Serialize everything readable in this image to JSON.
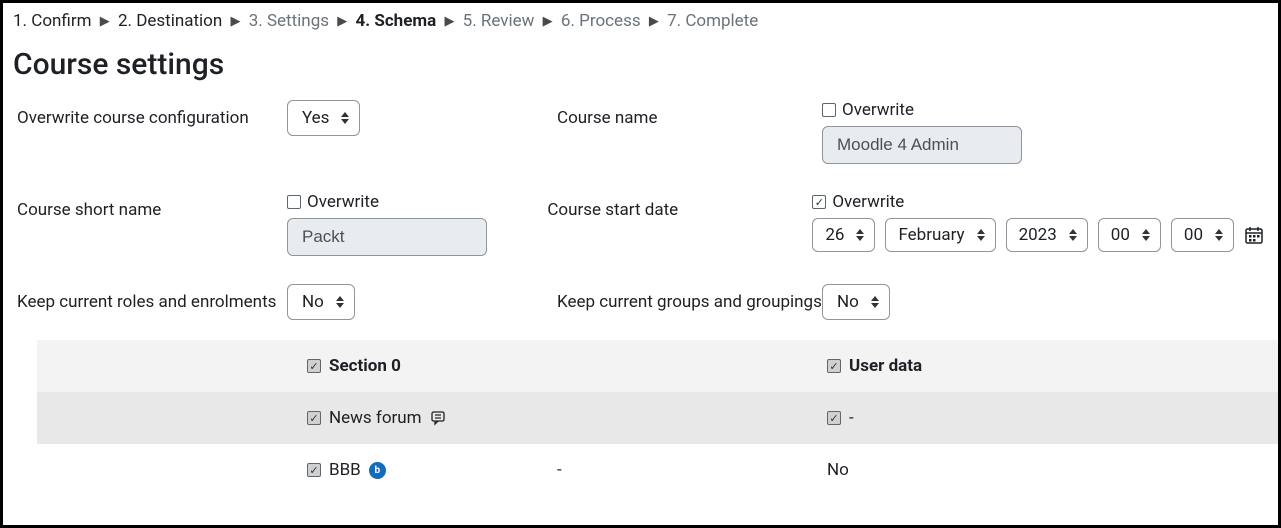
{
  "breadcrumb": {
    "step1": "1. Confirm",
    "step2": "2. Destination",
    "step3": "3. Settings",
    "step4": "4. Schema",
    "step5": "5. Review",
    "step6": "6. Process",
    "step7": "7. Complete"
  },
  "page_title": "Course settings",
  "labels": {
    "overwrite_config": "Overwrite course configuration",
    "course_name": "Course name",
    "course_short_name": "Course short name",
    "course_start_date": "Course start date",
    "keep_roles": "Keep current roles and enrolments",
    "keep_groups": "Keep current groups and groupings",
    "overwrite": "Overwrite"
  },
  "values": {
    "overwrite_config_select": "Yes",
    "course_name_input": "Moodle 4 Admin",
    "course_short_name_input": "Packt",
    "date_day": "26",
    "date_month": "February",
    "date_year": "2023",
    "date_hour": "00",
    "date_minute": "00",
    "keep_roles_select": "No",
    "keep_groups_select": "No"
  },
  "checks": {
    "course_name_overwrite": false,
    "course_short_name_overwrite": false,
    "course_start_date_overwrite": true
  },
  "sections": {
    "section0_label": "Section 0",
    "user_data_label": "User data",
    "item1_label": "News forum",
    "item1_userdata": "-",
    "item2_label": "BBB",
    "item2_mid": "-",
    "item2_userdata": "No",
    "bbb_initial": "b"
  }
}
